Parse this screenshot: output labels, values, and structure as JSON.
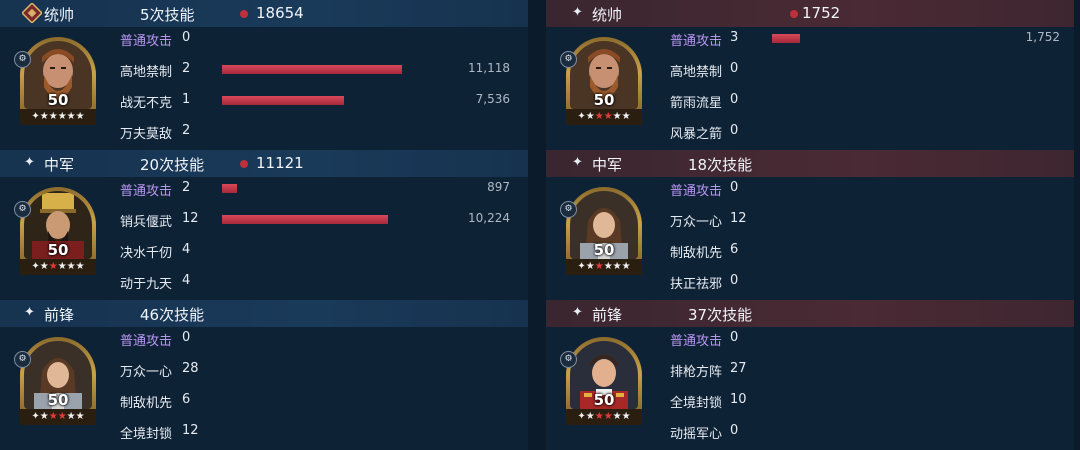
{
  "left": {
    "sections": [
      {
        "role": "统帅",
        "casts": "5次技能",
        "total": "18654",
        "level": "50",
        "stars": [
          "s",
          "s",
          "s",
          "s",
          "s"
        ],
        "skills": [
          {
            "name": "普通攻击",
            "count": "0",
            "damage": "",
            "bar": 0,
            "basic": true
          },
          {
            "name": "高地禁制",
            "count": "2",
            "damage": "11,118",
            "bar": 11118,
            "basic": false
          },
          {
            "name": "战无不克",
            "count": "1",
            "damage": "7,536",
            "bar": 7536,
            "basic": false
          },
          {
            "name": "万夫莫敌",
            "count": "2",
            "damage": "",
            "bar": 0,
            "basic": false
          }
        ]
      },
      {
        "role": "中军",
        "casts": "20次技能",
        "total": "11121",
        "level": "50",
        "stars": [
          "s",
          "r",
          "s",
          "s",
          "s"
        ],
        "skills": [
          {
            "name": "普通攻击",
            "count": "2",
            "damage": "897",
            "bar": 897,
            "basic": true
          },
          {
            "name": "销兵偃武",
            "count": "12",
            "damage": "10,224",
            "bar": 10224,
            "basic": false
          },
          {
            "name": "决水千仞",
            "count": "4",
            "damage": "",
            "bar": 0,
            "basic": false
          },
          {
            "name": "动于九天",
            "count": "4",
            "damage": "",
            "bar": 0,
            "basic": false
          }
        ]
      },
      {
        "role": "前锋",
        "casts": "46次技能",
        "total": "",
        "level": "50",
        "stars": [
          "s",
          "r",
          "r",
          "s",
          "s"
        ],
        "skills": [
          {
            "name": "普通攻击",
            "count": "0",
            "damage": "",
            "bar": 0,
            "basic": true
          },
          {
            "name": "万众一心",
            "count": "28",
            "damage": "",
            "bar": 0,
            "basic": false
          },
          {
            "name": "制敌机先",
            "count": "6",
            "damage": "",
            "bar": 0,
            "basic": false
          },
          {
            "name": "全境封锁",
            "count": "12",
            "damage": "",
            "bar": 0,
            "basic": false
          }
        ]
      }
    ]
  },
  "right": {
    "sections": [
      {
        "role": "统帅",
        "casts": "",
        "total": "1752",
        "level": "50",
        "stars": [
          "s",
          "r",
          "r",
          "s",
          "s"
        ],
        "skills": [
          {
            "name": "普通攻击",
            "count": "3",
            "damage": "1,752",
            "bar": 1752,
            "basic": true
          },
          {
            "name": "高地禁制",
            "count": "0",
            "damage": "",
            "bar": 0,
            "basic": false
          },
          {
            "name": "箭雨流星",
            "count": "0",
            "damage": "",
            "bar": 0,
            "basic": false
          },
          {
            "name": "风暴之箭",
            "count": "0",
            "damage": "",
            "bar": 0,
            "basic": false
          }
        ]
      },
      {
        "role": "中军",
        "casts": "18次技能",
        "total": "",
        "level": "50",
        "stars": [
          "s",
          "r",
          "s",
          "s",
          "s"
        ],
        "skills": [
          {
            "name": "普通攻击",
            "count": "0",
            "damage": "",
            "bar": 0,
            "basic": true
          },
          {
            "name": "万众一心",
            "count": "12",
            "damage": "",
            "bar": 0,
            "basic": false
          },
          {
            "name": "制敌机先",
            "count": "6",
            "damage": "",
            "bar": 0,
            "basic": false
          },
          {
            "name": "扶正祛邪",
            "count": "0",
            "damage": "",
            "bar": 0,
            "basic": false
          }
        ]
      },
      {
        "role": "前锋",
        "casts": "37次技能",
        "total": "",
        "level": "50",
        "stars": [
          "s",
          "r",
          "r",
          "s",
          "s"
        ],
        "skills": [
          {
            "name": "普通攻击",
            "count": "0",
            "damage": "",
            "bar": 0,
            "basic": true
          },
          {
            "name": "排枪方阵",
            "count": "27",
            "damage": "",
            "bar": 0,
            "basic": false
          },
          {
            "name": "全境封锁",
            "count": "10",
            "damage": "",
            "bar": 0,
            "basic": false
          },
          {
            "name": "动摇军心",
            "count": "0",
            "damage": "",
            "bar": 0,
            "basic": false
          }
        ]
      }
    ]
  },
  "colors": {
    "bar": "#c23a4a",
    "basic_skill": "#b895f0",
    "dot": "#c0303a"
  },
  "icons": {
    "commander_badge": "shield-badge-icon",
    "section_marker": "sparkle-icon",
    "card_mark": "gear-icon",
    "star": "star-icon"
  }
}
